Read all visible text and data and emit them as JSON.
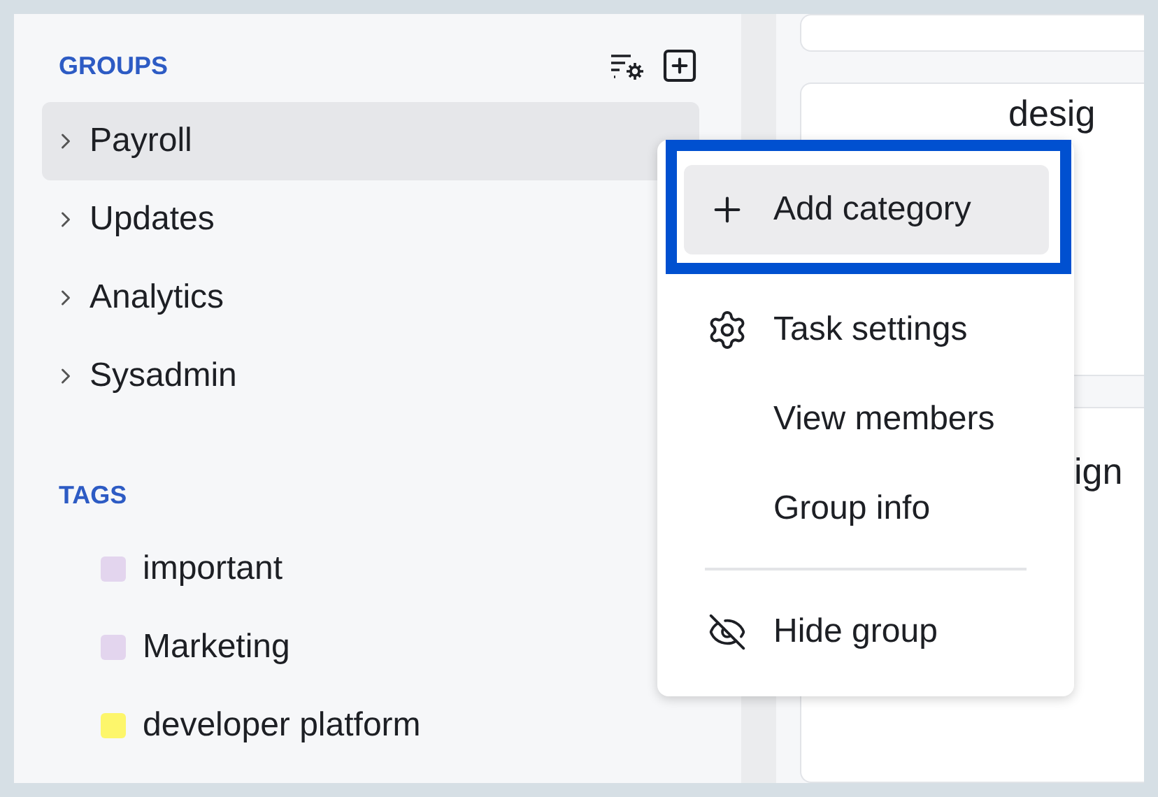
{
  "sidebar": {
    "groups_title": "GROUPS",
    "groups": [
      {
        "label": "Payroll",
        "selected": true,
        "expanded": false
      },
      {
        "label": "Updates",
        "selected": false,
        "expanded": false
      },
      {
        "label": "Analytics",
        "selected": false,
        "expanded": false
      },
      {
        "label": "Sysadmin",
        "selected": false,
        "expanded": false
      }
    ],
    "tags_title": "TAGS",
    "tags": [
      {
        "label": "important",
        "color": "#e3d5ee"
      },
      {
        "label": "Marketing",
        "color": "#e3d5ee"
      },
      {
        "label": "developer platform",
        "color": "#fdf66b"
      }
    ]
  },
  "cards": [
    {
      "kind": "blank"
    },
    {
      "kind": "titled",
      "title": "desig"
    },
    {
      "kind": "titled",
      "title": "ign"
    }
  ],
  "context_menu": {
    "items": [
      {
        "label": "Add category",
        "kind": "plus",
        "selected": true,
        "divider_before": false
      },
      {
        "label": "Task settings",
        "kind": "gear",
        "selected": false,
        "divider_before": false
      },
      {
        "label": "View members",
        "kind": "none",
        "selected": false,
        "divider_before": false
      },
      {
        "label": "Group info",
        "kind": "none",
        "selected": false,
        "divider_before": false
      },
      {
        "label": "Hide group",
        "kind": "eye-off",
        "selected": false,
        "divider_before": true
      }
    ]
  }
}
